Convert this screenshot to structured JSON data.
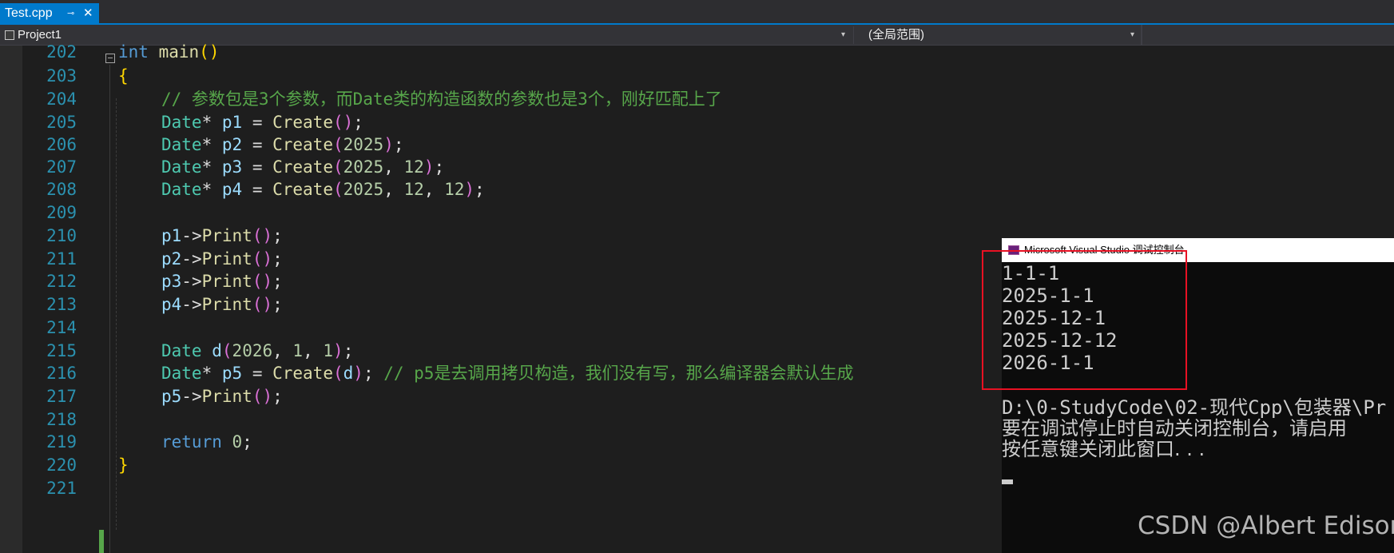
{
  "tab": {
    "label": "Test.cpp",
    "pin_glyph": "⊸",
    "close_glyph": "✕"
  },
  "nav": {
    "project": "Project1",
    "scope": "(全局范围)"
  },
  "editor": {
    "line_numbers": [
      "202",
      "203",
      "204",
      "205",
      "206",
      "207",
      "208",
      "209",
      "210",
      "211",
      "212",
      "213",
      "214",
      "215",
      "216",
      "217",
      "218",
      "219",
      "220",
      "221"
    ],
    "code": {
      "l202": {
        "kw": "int",
        "fn": "main",
        "open": "(",
        "close": ")"
      },
      "l203": {
        "brace": "{"
      },
      "l204": {
        "comment": "// 参数包是3个参数，而Date类的构造函数的参数也是3个，刚好匹配上了"
      },
      "l205": {
        "type": "Date",
        "star": "* ",
        "var": "p1",
        "eq": " = ",
        "fn": "Create",
        "open": "(",
        "args": "",
        "close": ")",
        "semi": ";"
      },
      "l206": {
        "type": "Date",
        "star": "* ",
        "var": "p2",
        "eq": " = ",
        "fn": "Create",
        "open": "(",
        "args": "2025",
        "close": ")",
        "semi": ";"
      },
      "l207": {
        "type": "Date",
        "star": "* ",
        "var": "p3",
        "eq": " = ",
        "fn": "Create",
        "open": "(",
        "a1": "2025",
        "c1": ", ",
        "a2": "12",
        "close": ")",
        "semi": ";"
      },
      "l208": {
        "type": "Date",
        "star": "* ",
        "var": "p4",
        "eq": " = ",
        "fn": "Create",
        "open": "(",
        "a1": "2025",
        "c1": ", ",
        "a2": "12",
        "c2": ", ",
        "a3": "12",
        "close": ")",
        "semi": ";"
      },
      "l210": {
        "var": "p1",
        "arrow": "->",
        "fn": "Print",
        "open": "(",
        "close": ")",
        "semi": ";"
      },
      "l211": {
        "var": "p2",
        "arrow": "->",
        "fn": "Print",
        "open": "(",
        "close": ")",
        "semi": ";"
      },
      "l212": {
        "var": "p3",
        "arrow": "->",
        "fn": "Print",
        "open": "(",
        "close": ")",
        "semi": ";"
      },
      "l213": {
        "var": "p4",
        "arrow": "->",
        "fn": "Print",
        "open": "(",
        "close": ")",
        "semi": ";"
      },
      "l215": {
        "type": "Date",
        "sp": " ",
        "var": "d",
        "open": "(",
        "a1": "2026",
        "c1": ", ",
        "a2": "1",
        "c2": ", ",
        "a3": "1",
        "close": ")",
        "semi": ";"
      },
      "l216": {
        "type": "Date",
        "star": "* ",
        "var": "p5",
        "eq": " = ",
        "fn": "Create",
        "open": "(",
        "arg": "d",
        "close": ")",
        "semi": "; ",
        "comment": "// p5是去调用拷贝构造，我们没有写，那么编译器会默认生成"
      },
      "l217": {
        "var": "p5",
        "arrow": "->",
        "fn": "Print",
        "open": "(",
        "close": ")",
        "semi": ";"
      },
      "l219": {
        "kw": "return",
        "sp": " ",
        "num": "0",
        "semi": ";"
      },
      "l220": {
        "brace": "}"
      }
    }
  },
  "console": {
    "title": "Microsoft Visual Studio 调试控制台",
    "output": [
      "1-1-1",
      "2025-1-1",
      "2025-12-1",
      "2025-12-12",
      "2026-1-1"
    ],
    "path_line": "D:\\0-StudyCode\\02-现代Cpp\\包装器\\Pr",
    "hint_line": "要在调试停止时自动关闭控制台，请启用",
    "press_line": "按任意键关闭此窗口. . ."
  },
  "watermark": "CSDN @Albert Edison",
  "colors": {
    "accent": "#007acc",
    "keyword": "#569cd6",
    "type": "#4ec9b0",
    "function": "#dcdcaa",
    "variable": "#9cdcfe",
    "number": "#b5cea8",
    "comment": "#57a64a",
    "highlight": "#e81123"
  }
}
